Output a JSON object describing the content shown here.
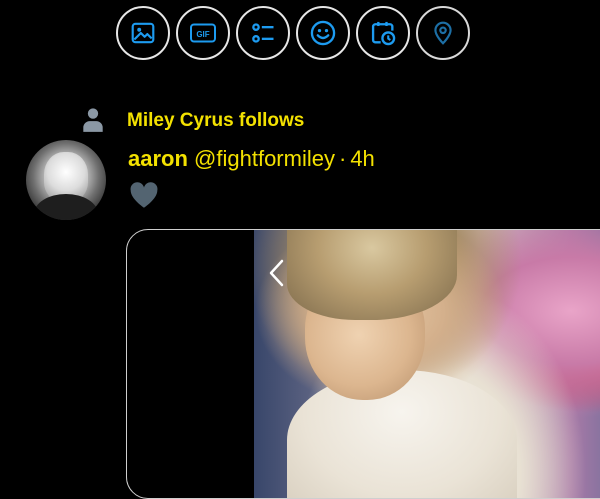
{
  "composer_toolbar": {
    "icons": [
      "image-icon",
      "gif-icon",
      "poll-icon",
      "emoji-icon",
      "schedule-icon",
      "location-icon"
    ],
    "gif_label": "GIF",
    "icon_color": "#1d9bf0",
    "location_icon_color": "#1d6fa5"
  },
  "tweet": {
    "social_context": "Miley Cyrus follows",
    "author_name": "aaron",
    "author_handle": "@fightformiley",
    "separator": "·",
    "time": "4h",
    "text_color": "#f3e100"
  },
  "media": {
    "nav_icon": "chevron-left-icon"
  }
}
